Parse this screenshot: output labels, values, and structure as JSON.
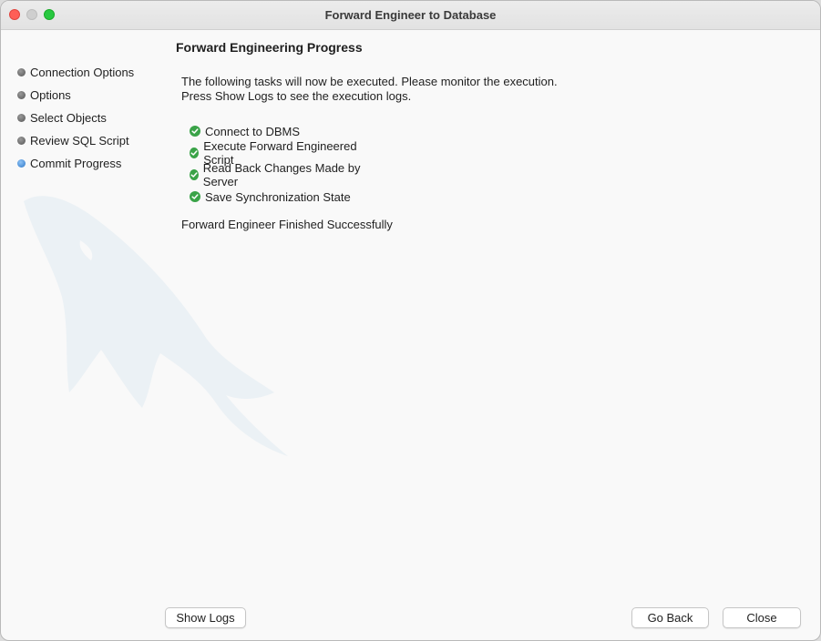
{
  "window": {
    "title": "Forward Engineer to Database"
  },
  "sidebar": {
    "items": [
      {
        "label": "Connection Options",
        "state": "done"
      },
      {
        "label": "Options",
        "state": "done"
      },
      {
        "label": "Select Objects",
        "state": "done"
      },
      {
        "label": "Review SQL Script",
        "state": "done"
      },
      {
        "label": "Commit Progress",
        "state": "active"
      }
    ]
  },
  "main": {
    "heading": "Forward Engineering Progress",
    "description_line1": "The following tasks will now be executed. Please monitor the execution.",
    "description_line2": "Press Show Logs to see the execution logs.",
    "tasks": [
      {
        "label": "Connect to DBMS",
        "status": "completed"
      },
      {
        "label": "Execute Forward Engineered Script",
        "status": "completed"
      },
      {
        "label": "Read Back Changes Made by Server",
        "status": "completed"
      },
      {
        "label": "Save Synchronization State",
        "status": "completed"
      }
    ],
    "result_message": "Forward Engineer Finished Successfully"
  },
  "buttons": {
    "show_logs": "Show Logs",
    "go_back": "Go Back",
    "close": "Close"
  },
  "colors": {
    "check_green": "#3aa348",
    "active_step_blue": "#2e77c8",
    "close_light": "#fe5f57",
    "zoom_light": "#28c840"
  },
  "icons": {
    "watermark": "mysql-dolphin-icon",
    "task_status": "checkmark-circle-icon"
  }
}
